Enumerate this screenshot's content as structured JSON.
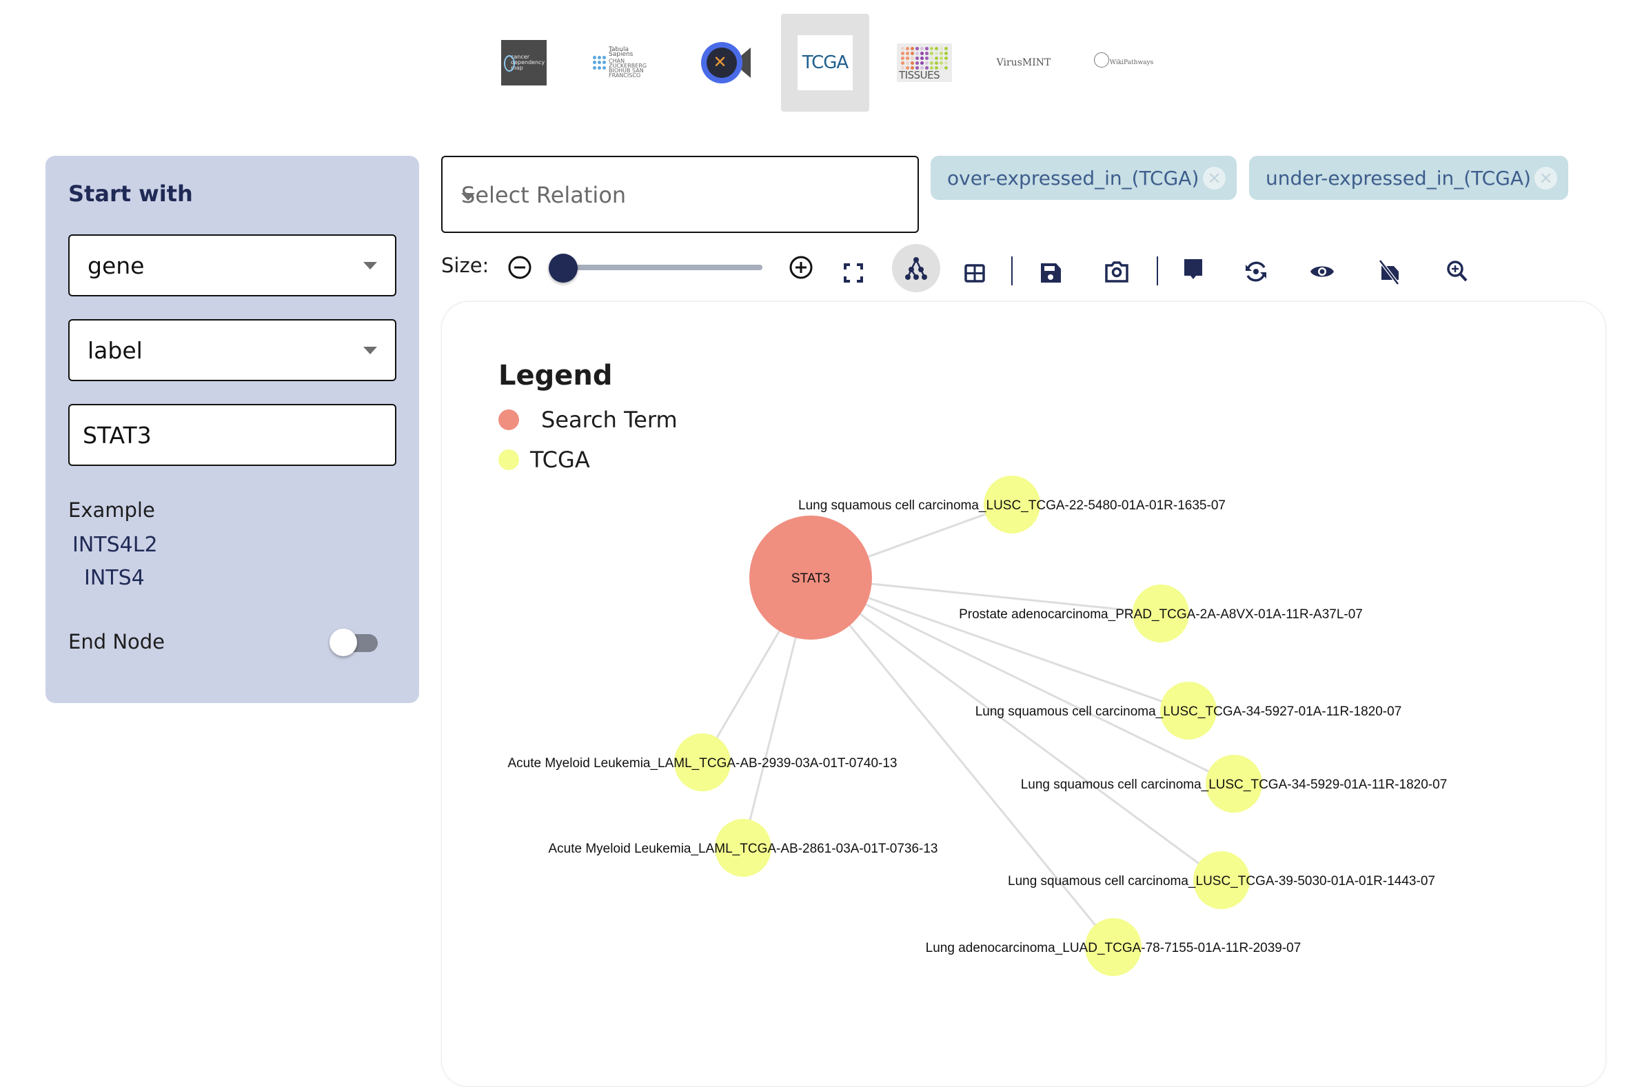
{
  "sources": [
    {
      "id": "depmap",
      "label": "cancer dependency map",
      "selected": false
    },
    {
      "id": "tabula",
      "label": "Tabula Sapiens",
      "sublabel": "CHAN ZUCKERBERG BIOHUB SAN FRANCISCO",
      "selected": false
    },
    {
      "id": "target",
      "label": "",
      "selected": false
    },
    {
      "id": "tcga",
      "label": "TCGA",
      "selected": true
    },
    {
      "id": "tissues",
      "label": "TISSUES",
      "selected": false
    },
    {
      "id": "virusmint",
      "label": "VirusMINT",
      "selected": false
    },
    {
      "id": "wikipathways",
      "label": "WikiPathways",
      "selected": false
    }
  ],
  "left_panel": {
    "title": "Start with",
    "node_type": "gene",
    "attribute": "label",
    "search_value": "STAT3",
    "example_label": "Example",
    "examples": [
      "INTS4L2",
      "INTS4"
    ],
    "end_node_label": "End Node",
    "end_node_enabled": false
  },
  "relation": {
    "placeholder": "Select Relation",
    "chips": [
      "over-expressed_in_(TCGA)",
      "under-expressed_in_(TCGA)"
    ]
  },
  "toolbar": {
    "size_label": "Size:",
    "size_value": 0,
    "buttons": [
      "zoom-out",
      "zoom-in",
      "fullscreen",
      "network-view",
      "table-view",
      "save",
      "screenshot",
      "comment",
      "reset-layout",
      "show",
      "hide-labels",
      "zoom-search"
    ],
    "active": "network-view"
  },
  "legend": {
    "title": "Legend",
    "items": [
      {
        "label": "Search Term",
        "color": "#f08e80"
      },
      {
        "label": "TCGA",
        "color": "#f4fd8e"
      }
    ]
  },
  "graph": {
    "center": {
      "label": "STAT3",
      "color": "#f08e80"
    },
    "edge_color": "#dddddd",
    "node_color": "#f4fd8e",
    "nodes": [
      {
        "label": "Lung squamous cell carcinoma_LUSC_TCGA-22-5480-01A-01R-1635-07"
      },
      {
        "label": "Prostate adenocarcinoma_PRAD_TCGA-2A-A8VX-01A-11R-A37L-07"
      },
      {
        "label": "Lung squamous cell carcinoma_LUSC_TCGA-34-5927-01A-11R-1820-07"
      },
      {
        "label": "Lung squamous cell carcinoma_LUSC_TCGA-34-5929-01A-11R-1820-07"
      },
      {
        "label": "Lung squamous cell carcinoma_LUSC_TCGA-39-5030-01A-01R-1443-07"
      },
      {
        "label": "Lung adenocarcinoma_LUAD_TCGA-78-7155-01A-11R-2039-07"
      },
      {
        "label": "Acute Myeloid Leukemia_LAML_TCGA-AB-2939-03A-01T-0740-13"
      },
      {
        "label": "Acute Myeloid Leukemia_LAML_TCGA-AB-2861-03A-01T-0736-13"
      }
    ]
  },
  "colors": {
    "accent": "#202a55",
    "panel_bg": "#ccd2e6",
    "chip_bg": "#c7dfe5",
    "chip_text": "#3e5d8c"
  }
}
